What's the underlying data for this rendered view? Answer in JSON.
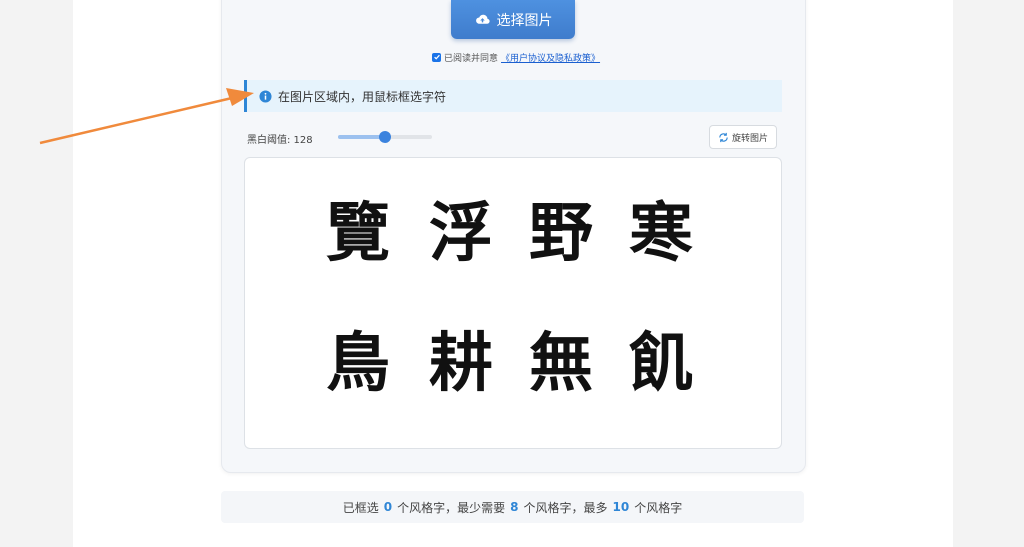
{
  "upload": {
    "label": "选择图片",
    "icon": "cloud-upload-icon"
  },
  "agreement": {
    "checked": true,
    "text": "已阅读并同意",
    "link": "《用户协议及隐私政策》"
  },
  "notice": {
    "icon": "info-icon",
    "text": "在图片区域内，用鼠标框选字符"
  },
  "threshold": {
    "label": "黑白阈值: 128",
    "value": 128,
    "max": 255
  },
  "rotate": {
    "label": "旋转图片",
    "icon": "rotate-icon"
  },
  "canvas": {
    "characters": [
      "覽",
      "浮",
      "野",
      "寒",
      "鳥",
      "耕",
      "無",
      "飢"
    ]
  },
  "counter": {
    "prefix": "已框选",
    "selected": "0",
    "mid1": "个风格字，最少需要",
    "min": "8",
    "mid2": "个风格字，最多",
    "max": "10",
    "suffix": "个风格字"
  },
  "colors": {
    "accent": "#3b83de",
    "notice_bg": "#e6f3fc",
    "arrow": "#f08a3c"
  }
}
